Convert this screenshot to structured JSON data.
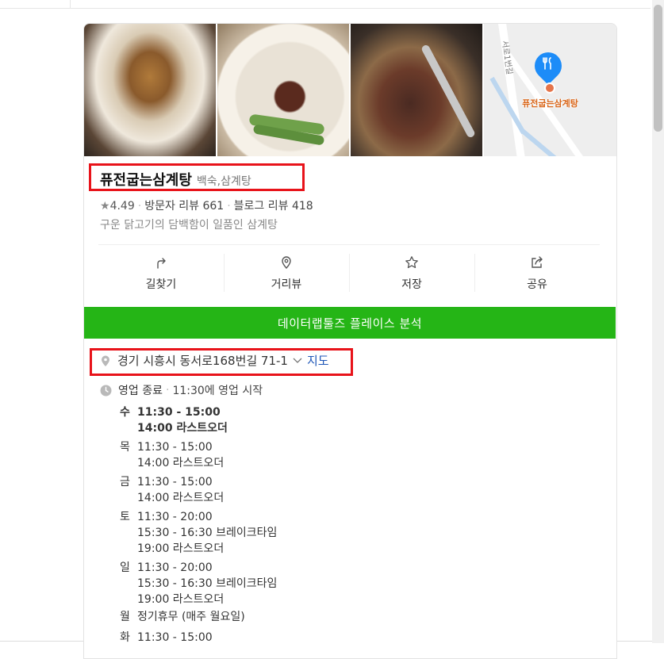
{
  "place": {
    "name": "퓨전굽는삼계탕",
    "category": "백숙,삼계탕",
    "star_glyph": "★",
    "rating": "4.49",
    "visitor_reviews": "방문자 리뷰 661",
    "blog_reviews": "블로그 리뷰 418",
    "description": "구운 닭고기의 담백함이 일품인 삼계탕"
  },
  "map": {
    "pin_label": "퓨전굽는삼계탕",
    "road_label": "서로1번길"
  },
  "actions": [
    {
      "label": "길찾기",
      "icon": "directions-icon"
    },
    {
      "label": "거리뷰",
      "icon": "map-pin-icon"
    },
    {
      "label": "저장",
      "icon": "star-icon"
    },
    {
      "label": "공유",
      "icon": "share-icon"
    }
  ],
  "banner": {
    "label": "데이터랩툴즈 플레이스 분석",
    "color": "#25b516"
  },
  "address": {
    "text": "경기 시흥시 동서로168번길 71-1",
    "map_link": "지도"
  },
  "status": {
    "closed": "영업 종료",
    "next": "11:30에 영업 시작"
  },
  "hours": [
    {
      "day": "수",
      "lines": [
        "11:30 - 15:00",
        "14:00 라스트오더"
      ],
      "bold": true
    },
    {
      "day": "목",
      "lines": [
        "11:30 - 15:00",
        "14:00 라스트오더"
      ]
    },
    {
      "day": "금",
      "lines": [
        "11:30 - 15:00",
        "14:00 라스트오더"
      ]
    },
    {
      "day": "토",
      "lines": [
        "11:30 - 20:00",
        "15:30 - 16:30 브레이크타임",
        "19:00 라스트오더"
      ]
    },
    {
      "day": "일",
      "lines": [
        "11:30 - 20:00",
        "15:30 - 16:30 브레이크타임",
        "19:00 라스트오더"
      ]
    },
    {
      "day": "월",
      "lines": [
        "정기휴무 (매주 월요일)"
      ]
    },
    {
      "day": "화",
      "lines": [
        "11:30 - 15:00"
      ]
    }
  ]
}
